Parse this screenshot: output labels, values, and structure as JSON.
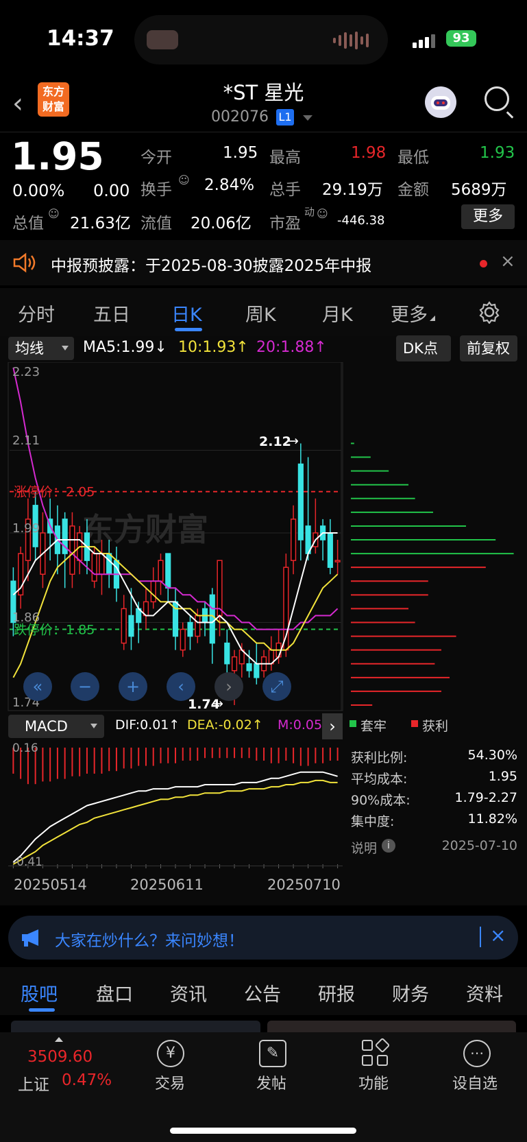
{
  "status_bar": {
    "time": "14:37",
    "battery": "93"
  },
  "header": {
    "logo_text": "东方财富",
    "title": "*ST 星光",
    "code": "002076",
    "level_badge": "L1"
  },
  "quote": {
    "price": "1.95",
    "change_pct": "0.00%",
    "change": "0.00",
    "open_label": "今开",
    "open": "1.95",
    "high_label": "最高",
    "high": "1.98",
    "low_label": "最低",
    "low": "1.93",
    "turnover_label": "换手",
    "turnover": "2.84%",
    "volume_label": "总手",
    "volume": "29.19万",
    "amount_label": "金额",
    "amount": "5689万",
    "mktcap_label": "总值",
    "mktcap": "21.63亿",
    "float_label": "流值",
    "float": "20.06亿",
    "pe_label": "市盈",
    "pe_sup": "动",
    "pe": "-446.38",
    "more_button": "更多"
  },
  "notice": {
    "text": "中报预披露：于2025-08-30披露2025年中报"
  },
  "chart_tabs": [
    "分时",
    "五日",
    "日K",
    "周K",
    "月K",
    "更多"
  ],
  "active_chart_tab": "日K",
  "ma_bar": {
    "dropdown": "均线",
    "ma5": "MA5:1.99",
    "ma10": "10:1.93",
    "ma20": "20:1.88",
    "dk_button": "DK点",
    "adjust_button": "前复权"
  },
  "kline_labels": {
    "y_top": "2.23",
    "y_mid1": "2.11",
    "y_mid2": "1.99",
    "y_mid3": "1.86",
    "y_bottom": "1.74",
    "limit_up": "涨停价：2.05",
    "limit_down": "跌停价：1.85",
    "high_marker": "2.12",
    "low_marker": "1.74",
    "watermark": "东方财富"
  },
  "macd_bar": {
    "dropdown": "MACD",
    "dif": "DIF:0.01",
    "dea": "DEA:-0.02",
    "m": "M:0.05"
  },
  "macd_labels": {
    "y_top": "0.16",
    "y_bottom": "-0.41"
  },
  "dates": [
    "20250514",
    "20250611",
    "20250710"
  ],
  "chip_legend": {
    "trapped": "套牢",
    "profit": "获利"
  },
  "chip_info": [
    {
      "label": "获利比例:",
      "value": "54.30%"
    },
    {
      "label": "平均成本:",
      "value": "1.95"
    },
    {
      "label": "90%成本:",
      "value": "1.79-2.27"
    },
    {
      "label": "集中度:",
      "value": "11.82%"
    }
  ],
  "chip_note": {
    "label": "说明",
    "date": "2025-07-10"
  },
  "ai_bar": {
    "text": "大家在炒什么？来问妙想！"
  },
  "section_tabs": [
    "股吧",
    "盘口",
    "资讯",
    "公告",
    "研报",
    "财务",
    "资料"
  ],
  "active_section_tab": "股吧",
  "bottom_nav": {
    "index_value": "3509.60",
    "index_name": "上证",
    "index_change": "0.47%",
    "items": [
      "交易",
      "发帖",
      "功能",
      "设自选"
    ]
  },
  "colors": {
    "up": "#e8262a",
    "down": "#22c44a",
    "accent": "#3a86ff",
    "cyan": "#39e3e3",
    "yellow": "#f2e33b",
    "magenta": "#d52ad0"
  },
  "chart_data": {
    "type": "candlestick",
    "ylim": [
      1.74,
      2.23
    ],
    "limit_up": 2.05,
    "limit_down": 1.85,
    "candles": [
      {
        "o": 1.92,
        "c": 1.86,
        "h": 1.94,
        "l": 1.84
      },
      {
        "o": 1.9,
        "c": 1.96,
        "h": 1.97,
        "l": 1.88
      },
      {
        "o": 1.95,
        "c": 2.01,
        "h": 2.04,
        "l": 1.92
      },
      {
        "o": 2.03,
        "c": 1.97,
        "h": 2.05,
        "l": 1.95
      },
      {
        "o": 1.93,
        "c": 1.99,
        "h": 2.02,
        "l": 1.91
      },
      {
        "o": 2.01,
        "c": 1.99,
        "h": 2.04,
        "l": 1.95
      },
      {
        "o": 2.0,
        "c": 1.96,
        "h": 2.03,
        "l": 1.93
      },
      {
        "o": 2.01,
        "c": 1.96,
        "h": 2.02,
        "l": 1.91
      },
      {
        "o": 1.93,
        "c": 2.0,
        "h": 2.02,
        "l": 1.91
      },
      {
        "o": 1.95,
        "c": 1.99,
        "h": 2.0,
        "l": 1.93
      },
      {
        "o": 1.99,
        "c": 1.95,
        "h": 2.01,
        "l": 1.93
      },
      {
        "o": 1.92,
        "c": 1.96,
        "h": 1.97,
        "l": 1.91
      },
      {
        "o": 1.93,
        "c": 1.96,
        "h": 1.98,
        "l": 1.9
      },
      {
        "o": 1.96,
        "c": 1.93,
        "h": 1.98,
        "l": 1.91
      },
      {
        "o": 1.95,
        "c": 1.91,
        "h": 1.97,
        "l": 1.89
      },
      {
        "o": 1.83,
        "c": 1.88,
        "h": 1.9,
        "l": 1.82
      },
      {
        "o": 1.87,
        "c": 1.84,
        "h": 1.91,
        "l": 1.82
      },
      {
        "o": 1.88,
        "c": 1.86,
        "h": 1.89,
        "l": 1.83
      },
      {
        "o": 1.87,
        "c": 1.89,
        "h": 1.91,
        "l": 1.85
      },
      {
        "o": 1.89,
        "c": 1.92,
        "h": 1.94,
        "l": 1.88
      },
      {
        "o": 1.92,
        "c": 1.95,
        "h": 1.96,
        "l": 1.9
      },
      {
        "o": 1.96,
        "c": 1.91,
        "h": 1.96,
        "l": 1.89
      },
      {
        "o": 1.89,
        "c": 1.84,
        "h": 1.91,
        "l": 1.82
      },
      {
        "o": 1.82,
        "c": 1.85,
        "h": 1.86,
        "l": 1.81
      },
      {
        "o": 1.86,
        "c": 1.84,
        "h": 1.87,
        "l": 1.82
      },
      {
        "o": 1.84,
        "c": 1.87,
        "h": 1.88,
        "l": 1.83
      },
      {
        "o": 1.88,
        "c": 1.86,
        "h": 1.89,
        "l": 1.84
      },
      {
        "o": 1.9,
        "c": 1.83,
        "h": 1.91,
        "l": 1.8
      },
      {
        "o": 1.87,
        "c": 1.95,
        "h": 1.95,
        "l": 1.84
      },
      {
        "o": 1.83,
        "c": 1.8,
        "h": 1.85,
        "l": 1.78
      },
      {
        "o": 1.79,
        "c": 1.81,
        "h": 1.82,
        "l": 1.74
      },
      {
        "o": 1.8,
        "c": 1.82,
        "h": 1.83,
        "l": 1.78
      },
      {
        "o": 1.8,
        "c": 1.79,
        "h": 1.82,
        "l": 1.78
      },
      {
        "o": 1.8,
        "c": 1.78,
        "h": 1.83,
        "l": 1.77
      },
      {
        "o": 1.79,
        "c": 1.81,
        "h": 1.82,
        "l": 1.78
      },
      {
        "o": 1.8,
        "c": 1.82,
        "h": 1.84,
        "l": 1.79
      },
      {
        "o": 1.81,
        "c": 1.83,
        "h": 1.85,
        "l": 1.8
      },
      {
        "o": 1.82,
        "c": 1.94,
        "h": 1.96,
        "l": 1.81
      },
      {
        "o": 1.95,
        "c": 2.01,
        "h": 2.03,
        "l": 1.93
      },
      {
        "o": 2.09,
        "c": 1.98,
        "h": 2.12,
        "l": 1.95
      },
      {
        "o": 2.0,
        "c": 1.96,
        "h": 2.1,
        "l": 1.95
      },
      {
        "o": 1.97,
        "c": 1.99,
        "h": 2.04,
        "l": 1.96
      },
      {
        "o": 2.0,
        "c": 1.98,
        "h": 2.01,
        "l": 1.95
      },
      {
        "o": 1.99,
        "c": 1.94,
        "h": 2.01,
        "l": 1.93
      },
      {
        "o": 1.95,
        "c": 1.95,
        "h": 1.98,
        "l": 1.93
      }
    ],
    "ma5": [
      1.9,
      1.91,
      1.93,
      1.95,
      1.96,
      1.97,
      1.98,
      1.98,
      1.98,
      1.98,
      1.97,
      1.96,
      1.96,
      1.95,
      1.94,
      1.92,
      1.9,
      1.88,
      1.87,
      1.87,
      1.88,
      1.89,
      1.89,
      1.88,
      1.87,
      1.86,
      1.86,
      1.86,
      1.87,
      1.86,
      1.84,
      1.82,
      1.81,
      1.8,
      1.8,
      1.8,
      1.81,
      1.84,
      1.88,
      1.92,
      1.96,
      1.98,
      1.99,
      1.99,
      1.99
    ],
    "ma10": [
      1.78,
      1.8,
      1.83,
      1.86,
      1.89,
      1.92,
      1.94,
      1.95,
      1.96,
      1.97,
      1.97,
      1.97,
      1.96,
      1.96,
      1.95,
      1.94,
      1.93,
      1.92,
      1.91,
      1.9,
      1.89,
      1.89,
      1.88,
      1.88,
      1.88,
      1.87,
      1.87,
      1.87,
      1.86,
      1.86,
      1.85,
      1.85,
      1.84,
      1.83,
      1.83,
      1.82,
      1.82,
      1.82,
      1.83,
      1.85,
      1.87,
      1.89,
      1.91,
      1.92,
      1.93
    ],
    "ma20": [
      2.23,
      2.18,
      2.12,
      2.07,
      2.03,
      2.0,
      1.98,
      1.97,
      1.96,
      1.95,
      1.94,
      1.93,
      1.93,
      1.93,
      1.93,
      1.93,
      1.93,
      1.92,
      1.92,
      1.92,
      1.92,
      1.91,
      1.91,
      1.9,
      1.9,
      1.89,
      1.89,
      1.88,
      1.88,
      1.87,
      1.87,
      1.86,
      1.86,
      1.85,
      1.85,
      1.85,
      1.85,
      1.85,
      1.85,
      1.86,
      1.86,
      1.87,
      1.87,
      1.87,
      1.88
    ],
    "macd": {
      "ylim": [
        -0.41,
        0.16
      ],
      "dif": [
        -0.4,
        -0.37,
        -0.33,
        -0.29,
        -0.26,
        -0.23,
        -0.21,
        -0.19,
        -0.17,
        -0.15,
        -0.13,
        -0.12,
        -0.11,
        -0.1,
        -0.09,
        -0.08,
        -0.07,
        -0.06,
        -0.06,
        -0.05,
        -0.05,
        -0.05,
        -0.04,
        -0.04,
        -0.04,
        -0.04,
        -0.03,
        -0.03,
        -0.03,
        -0.03,
        -0.03,
        -0.02,
        -0.02,
        -0.02,
        -0.01,
        0.0,
        0.0,
        0.01,
        0.02,
        0.03,
        0.03,
        0.03,
        0.03,
        0.02,
        0.01
      ],
      "dea": [
        -0.41,
        -0.39,
        -0.37,
        -0.35,
        -0.32,
        -0.3,
        -0.28,
        -0.26,
        -0.24,
        -0.22,
        -0.21,
        -0.19,
        -0.18,
        -0.17,
        -0.16,
        -0.15,
        -0.14,
        -0.13,
        -0.12,
        -0.11,
        -0.1,
        -0.1,
        -0.09,
        -0.09,
        -0.08,
        -0.08,
        -0.07,
        -0.07,
        -0.07,
        -0.06,
        -0.06,
        -0.06,
        -0.05,
        -0.05,
        -0.05,
        -0.04,
        -0.04,
        -0.03,
        -0.03,
        -0.02,
        -0.02,
        -0.01,
        -0.01,
        -0.02,
        -0.02
      ],
      "bars": [
        0.1,
        0.12,
        0.14,
        0.14,
        0.13,
        0.13,
        0.12,
        0.12,
        0.11,
        0.11,
        0.1,
        0.1,
        0.1,
        0.09,
        0.09,
        0.08,
        0.08,
        0.07,
        0.07,
        0.07,
        0.06,
        0.06,
        0.06,
        0.05,
        0.05,
        0.05,
        0.04,
        0.04,
        0.04,
        0.04,
        0.04,
        0.04,
        0.04,
        0.05,
        0.05,
        0.06,
        0.06,
        0.05,
        0.06,
        0.07,
        0.07,
        0.06,
        0.06,
        0.05,
        0.05
      ]
    },
    "chips": [
      {
        "price": 2.12,
        "share": 0.02,
        "type": "trapped"
      },
      {
        "price": 2.1,
        "share": 0.12,
        "type": "trapped"
      },
      {
        "price": 2.08,
        "share": 0.23,
        "type": "trapped"
      },
      {
        "price": 2.06,
        "share": 0.35,
        "type": "trapped"
      },
      {
        "price": 2.04,
        "share": 0.39,
        "type": "trapped"
      },
      {
        "price": 2.02,
        "share": 0.5,
        "type": "trapped"
      },
      {
        "price": 2.0,
        "share": 0.7,
        "type": "trapped"
      },
      {
        "price": 1.98,
        "share": 0.88,
        "type": "trapped"
      },
      {
        "price": 1.96,
        "share": 0.99,
        "type": "trapped"
      },
      {
        "price": 1.94,
        "share": 0.82,
        "type": "profit"
      },
      {
        "price": 1.92,
        "share": 0.47,
        "type": "profit"
      },
      {
        "price": 1.9,
        "share": 0.47,
        "type": "profit"
      },
      {
        "price": 1.88,
        "share": 0.35,
        "type": "profit"
      },
      {
        "price": 1.86,
        "share": 0.39,
        "type": "profit"
      },
      {
        "price": 1.84,
        "share": 0.64,
        "type": "profit"
      },
      {
        "price": 1.82,
        "share": 0.55,
        "type": "profit"
      },
      {
        "price": 1.8,
        "share": 0.51,
        "type": "profit"
      },
      {
        "price": 1.78,
        "share": 0.6,
        "type": "profit"
      },
      {
        "price": 1.76,
        "share": 0.55,
        "type": "profit"
      },
      {
        "price": 1.74,
        "share": 0.13,
        "type": "profit"
      },
      {
        "price": 1.72,
        "share": 0.03,
        "type": "profit"
      }
    ]
  }
}
